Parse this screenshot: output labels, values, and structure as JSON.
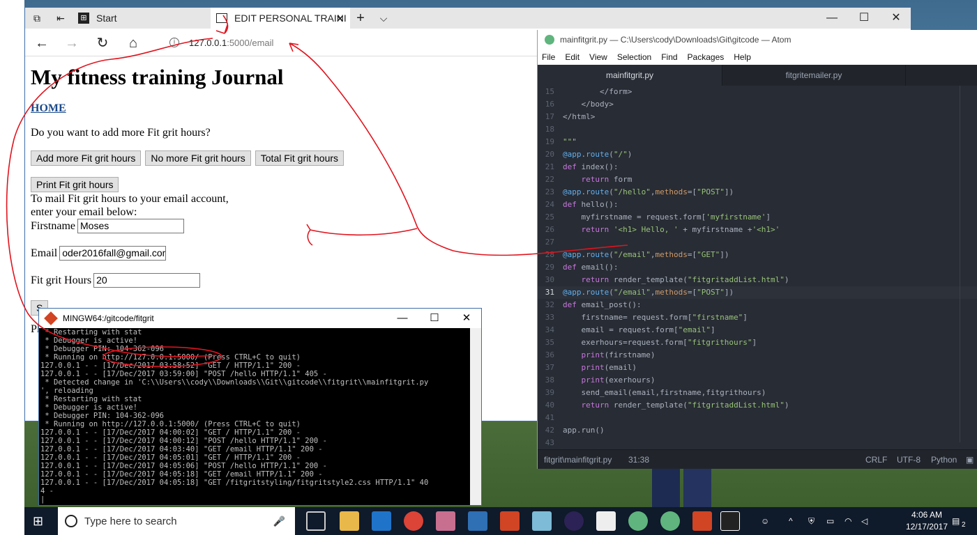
{
  "edge": {
    "tab_start_label": "Start",
    "tab_active_label": "EDIT PERSONAL TRAINI",
    "url_host": "127.0.0.1",
    "url_path": ":5000/email",
    "new_tab": "+",
    "tab_list": "⌵"
  },
  "page": {
    "title": "My fitness training Journal",
    "home_link": "HOME",
    "question": "Do you want to add more Fit grit hours?",
    "btn_add": "Add more Fit grit hours",
    "btn_no": "No more Fit grit hours",
    "btn_total": "Total Fit grit hours",
    "btn_print": "Print Fit grit hours",
    "mail_text_1": "To mail Fit grit hours to your email account,",
    "mail_text_2": "enter your email below:",
    "firstname_label": "Firstname",
    "firstname_value": "Moses",
    "email_label": "Email",
    "email_value": "oder2016fall@gmail.com",
    "hours_label": "Fit grit Hours",
    "hours_value": "20",
    "submit_partial": "S",
    "partial_text": "Pl"
  },
  "atom": {
    "title": "mainfitgrit.py — C:\\Users\\cody\\Downloads\\Git\\gitcode — Atom",
    "menu": [
      "File",
      "Edit",
      "View",
      "Selection",
      "Find",
      "Packages",
      "Help"
    ],
    "tabs": [
      "mainfitgrit.py",
      "fitgritemailer.py"
    ],
    "status_file": "fitgrit\\mainfitgrit.py",
    "status_pos": "31:38",
    "status_eol": "CRLF",
    "status_enc": "UTF-8",
    "status_lang": "Python",
    "code_lines": [
      {
        "n": "15",
        "t": "        </form>"
      },
      {
        "n": "16",
        "t": "    </body>"
      },
      {
        "n": "17",
        "t": "</html>"
      },
      {
        "n": "18",
        "t": ""
      },
      {
        "n": "19",
        "t": "\"\"\""
      },
      {
        "n": "20",
        "t": "@app.route(\"/\")"
      },
      {
        "n": "21",
        "t": "def index():"
      },
      {
        "n": "22",
        "t": "    return form"
      },
      {
        "n": "23",
        "t": "@app.route(\"/hello\",methods=[\"POST\"])"
      },
      {
        "n": "24",
        "t": "def hello():"
      },
      {
        "n": "25",
        "t": "    myfirstname = request.form['myfirstname']"
      },
      {
        "n": "26",
        "t": "    return '<h1> Hello, ' + myfirstname +'<h1>'"
      },
      {
        "n": "27",
        "t": ""
      },
      {
        "n": "28",
        "t": "@app.route(\"/email\",methods=[\"GET\"])"
      },
      {
        "n": "29",
        "t": "def email():"
      },
      {
        "n": "30",
        "t": "    return render_template(\"fitgritaddList.html\")"
      },
      {
        "n": "31",
        "t": "@app.route(\"/email\",methods=[\"POST\"])"
      },
      {
        "n": "32",
        "t": "def email_post():"
      },
      {
        "n": "33",
        "t": "    firstname= request.form[\"firstname\"]"
      },
      {
        "n": "34",
        "t": "    email = request.form[\"email\"]"
      },
      {
        "n": "35",
        "t": "    exerhours=request.form[\"fitgrithours\"]"
      },
      {
        "n": "36",
        "t": "    print(firstname)"
      },
      {
        "n": "37",
        "t": "    print(email)"
      },
      {
        "n": "38",
        "t": "    print(exerhours)"
      },
      {
        "n": "39",
        "t": "    send_email(email,firstname,fitgrithours)"
      },
      {
        "n": "40",
        "t": "    return render_template(\"fitgritaddList.html\")"
      },
      {
        "n": "41",
        "t": ""
      },
      {
        "n": "42",
        "t": "app.run()"
      },
      {
        "n": "43",
        "t": ""
      }
    ]
  },
  "mingw": {
    "title": "MINGW64:/gitcode/fitgrit",
    "lines": [
      " * Restarting with stat",
      " * Debugger is active!",
      " * Debugger PIN: 104-362-096",
      " * Running on http://127.0.0.1:5000/ (Press CTRL+C to quit)",
      "127.0.0.1 - - [17/Dec/2017 03:58:52] \"GET / HTTP/1.1\" 200 -",
      "127.0.0.1 - - [17/Dec/2017 03:59:00] \"POST /hello HTTP/1.1\" 405 -",
      " * Detected change in 'C:\\\\Users\\\\cody\\\\Downloads\\\\Git\\\\gitcode\\\\fitgrit\\\\mainfitgrit.py",
      "', reloading",
      " * Restarting with stat",
      " * Debugger is active!",
      " * Debugger PIN: 104-362-096",
      " * Running on http://127.0.0.1:5000/ (Press CTRL+C to quit)",
      "127.0.0.1 - - [17/Dec/2017 04:00:02] \"GET / HTTP/1.1\" 200 -",
      "127.0.0.1 - - [17/Dec/2017 04:00:12] \"POST /hello HTTP/1.1\" 200 -",
      "127.0.0.1 - - [17/Dec/2017 04:03:40] \"GET /email HTTP/1.1\" 200 -",
      "127.0.0.1 - - [17/Dec/2017 04:05:01] \"GET / HTTP/1.1\" 200 -",
      "127.0.0.1 - - [17/Dec/2017 04:05:06] \"POST /hello HTTP/1.1\" 200 -",
      "127.0.0.1 - - [17/Dec/2017 04:05:18] \"GET /email HTTP/1.1\" 200 -",
      "127.0.0.1 - - [17/Dec/2017 04:05:18] \"GET /fitgritstyling/fitgritstyle2.css HTTP/1.1\" 40",
      "4 -",
      "|"
    ]
  },
  "taskbar": {
    "search_placeholder": "Type here to search",
    "time": "4:06 AM",
    "date": "12/17/2017",
    "notifications": "2"
  },
  "colors": {
    "atom_bg": "#282c34",
    "keyword": "#c678dd",
    "function": "#61afef",
    "string": "#98c379",
    "decorator": "#61afef",
    "annotation_red": "#e0141e"
  }
}
